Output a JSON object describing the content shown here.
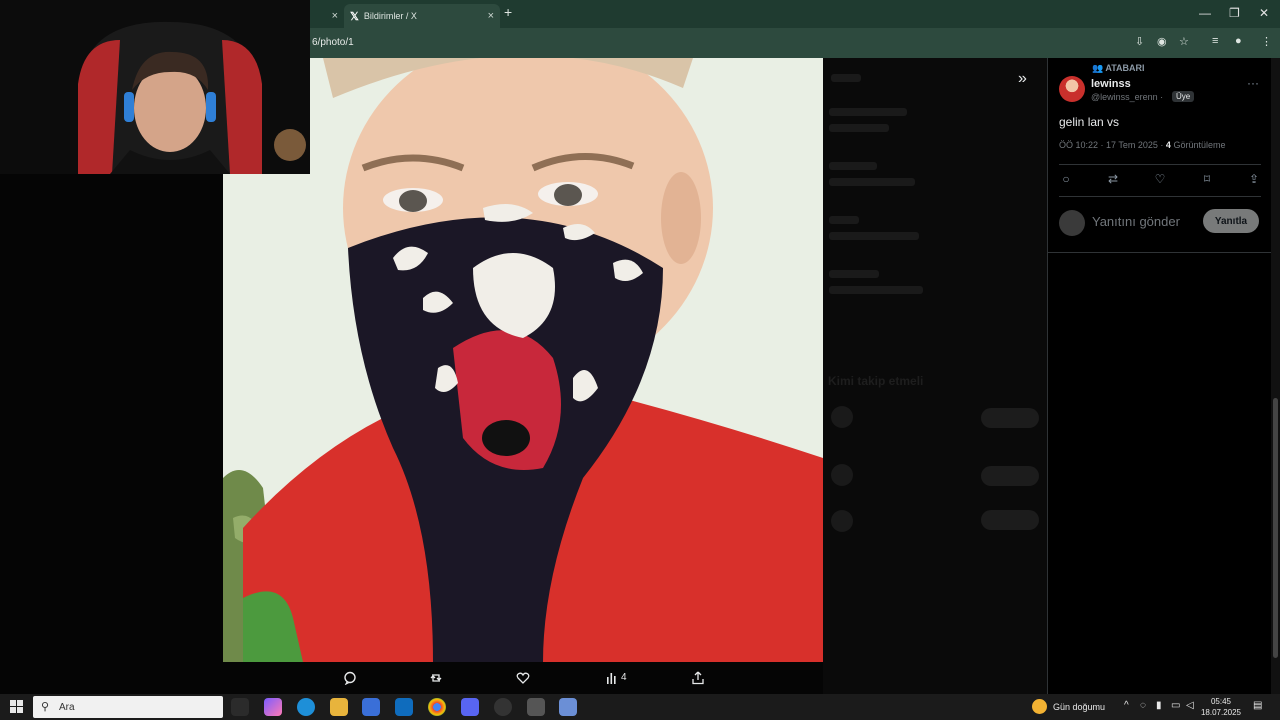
{
  "browser": {
    "tabs": [
      {
        "label": "",
        "active": false
      },
      {
        "label": "Bildirimler / X",
        "active": true
      }
    ],
    "url": "6/photo/1",
    "close_glyph": "×",
    "new_tab_glyph": "+",
    "window_controls": {
      "minimize": "—",
      "restore": "❐",
      "close": "✕"
    }
  },
  "viewer": {
    "views_count": "4"
  },
  "background_page": {
    "who_to_follow_title": "Kimi takip etmeli"
  },
  "tweet": {
    "pinned_label": "ATABARI",
    "author_name": "lewinss",
    "author_handle": "@lewinss_erenn ·",
    "badge": "Üye",
    "text": "gelin lan vs",
    "time": "ÖÖ 10:22 · 17 Tem 2025 ·",
    "views_number": "4",
    "views_label": "Görüntüleme",
    "reply_placeholder": "Yanıtını gönder",
    "reply_button": "Yanıtla"
  },
  "taskbar": {
    "search_placeholder": "Ara",
    "weather": "Gün doğumu",
    "time": "05:45",
    "date": "18.07.2025"
  },
  "icons": {
    "comment": "comment-icon",
    "retweet": "retweet-icon",
    "like": "heart-icon",
    "bookmark": "bookmark-icon",
    "share": "share-icon",
    "views": "bar-chart-icon"
  },
  "colors": {
    "browser_frame": "#1f3b30",
    "browser_toolbar": "#2d4a3e",
    "shirt_red": "#d8302b",
    "reply_button_bg": "#787a7a"
  }
}
